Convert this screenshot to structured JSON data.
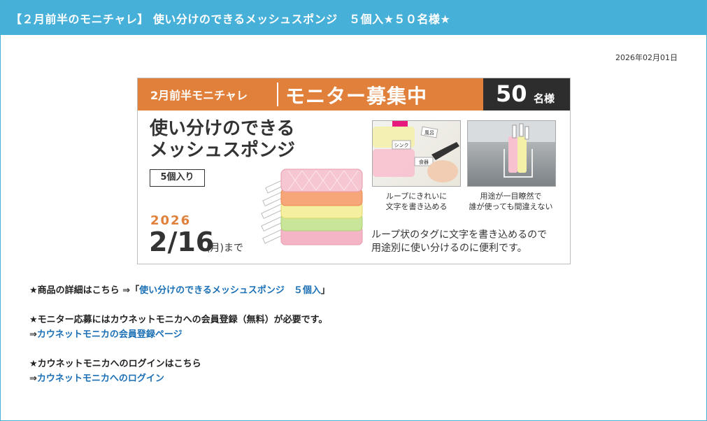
{
  "header": {
    "title": "【２月前半のモニチャレ】 使い分けのできるメッシュスポンジ　５個入★５０名様★"
  },
  "post": {
    "date": "2026年02月01日"
  },
  "banner": {
    "campaign": "2月前半モニチャレ",
    "headline": "モニター募集中",
    "count": "50",
    "count_unit": "名様",
    "product_line1": "使い分けのできる",
    "product_line2": "メッシュスポンジ",
    "quantity": "5個入り",
    "deadline_year": "2026",
    "deadline_date": "2/16",
    "deadline_suffix": "(月)まで",
    "photo1_caption_line1": "ループにきれいに",
    "photo1_caption_line2": "文字を書き込める",
    "photo2_caption_line1": "用途が一目瞭然で",
    "photo2_caption_line2": "誰が使っても間違えない",
    "description_line1": "ループ状のタグに文字を書き込めるので",
    "description_line2": "用途別に使い分けるのに便利です。",
    "tag_text_1": "シンク",
    "tag_text_2": "風呂",
    "tag_text_3": "食器",
    "colors": {
      "orange": "#e0803a",
      "dark": "#2d2d2d",
      "pink": "#f4b6c6",
      "green": "#c9e59a",
      "yellow": "#f5f0a0"
    }
  },
  "body": {
    "line1_prefix": "★商品の詳細はこちら ⇒「",
    "line1_link": "使い分けのできるメッシュスポンジ　５個入",
    "line1_suffix": "」",
    "line2": "★モニター応募にはカウネットモニカへの会員登録（無料）が必要です。",
    "line3_prefix": "⇒",
    "line3_link": "カウネットモニカの会員登録ページ",
    "line4": "★カウネットモニカへのログインはこちら",
    "line5_prefix": "⇒",
    "line5_link": "カウネットモニカへのログイン"
  }
}
